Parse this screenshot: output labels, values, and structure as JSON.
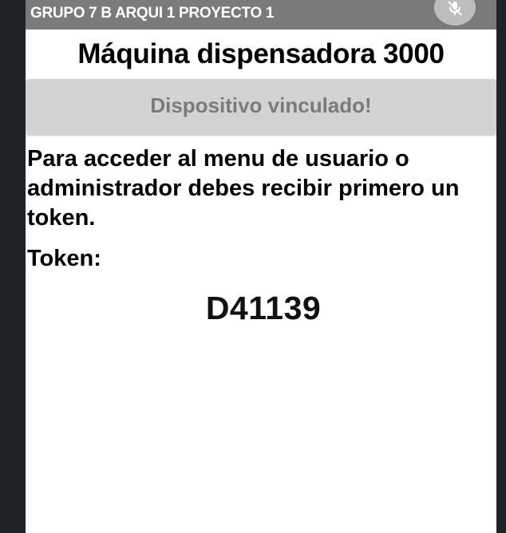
{
  "window": {
    "title": "GRUPO 7 B ARQUI 1 PROYECTO 1",
    "mic_icon": "mic-off-icon"
  },
  "main": {
    "app_title": "Máquina dispensadora 3000",
    "status_button_label": "Dispositivo vinculado!",
    "instructions": "Para acceder al menu de usuario o administrador debes recibir primero un token.",
    "token_label": "Token:",
    "token_value": "D41139"
  },
  "colors": {
    "titlebar": "#7a7a7a",
    "status_button_bg": "#d3d3d3",
    "status_button_text": "#7a7a7a",
    "background": "#ffffff",
    "outer_frame": "#202124"
  }
}
